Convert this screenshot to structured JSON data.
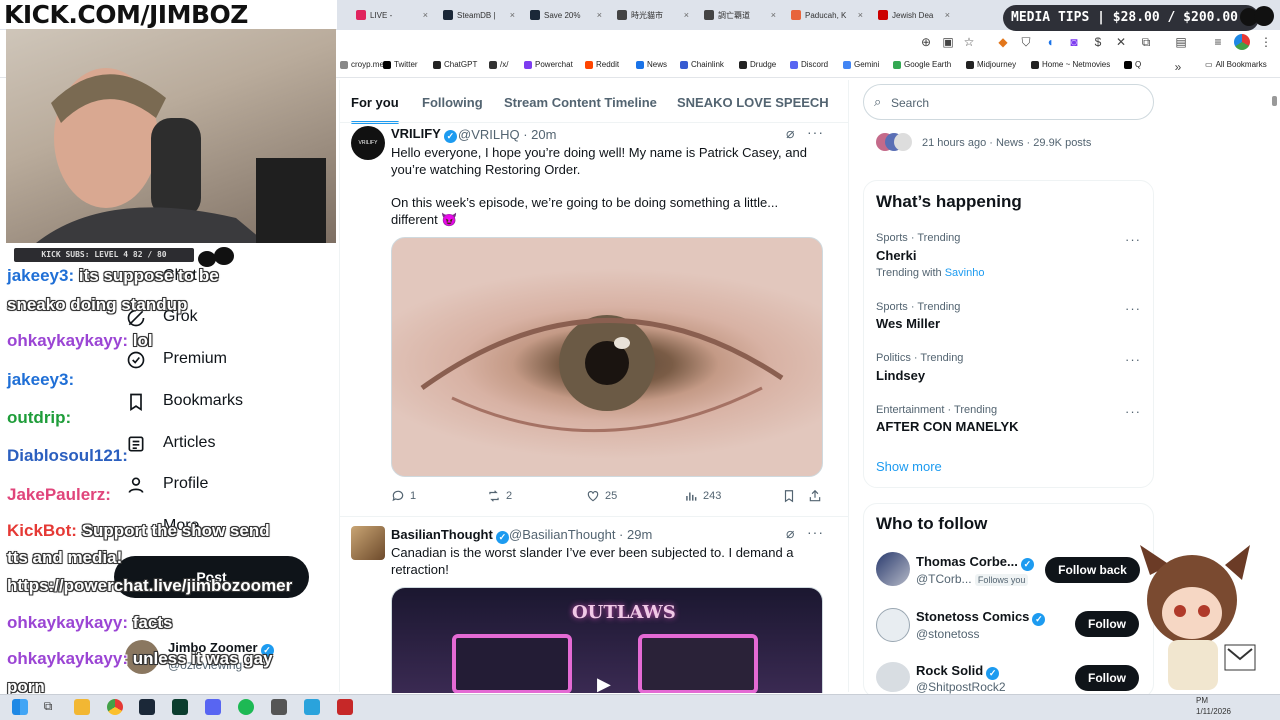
{
  "browser": {
    "tabs": [
      {
        "label": "LIVE - ",
        "color": "#e0245e"
      },
      {
        "label": "SteamDB |",
        "color": "#1b2838"
      },
      {
        "label": "Save 20%",
        "color": "#1b2838"
      },
      {
        "label": "時光貓市",
        "color": "#444444"
      },
      {
        "label": "調亡覇道",
        "color": "#444444"
      },
      {
        "label": "Paducah, K",
        "color": "#e8643b"
      },
      {
        "label": "Jewish Dea",
        "color": "#cc0000"
      }
    ],
    "bookmarks": [
      {
        "label": "croyp.me",
        "color": "#888888"
      },
      {
        "label": "Twitter",
        "color": "#000000"
      },
      {
        "label": "ChatGPT",
        "color": "#222222"
      },
      {
        "label": "/x/",
        "color": "#333333"
      },
      {
        "label": "Powerchat",
        "color": "#7d3cf0"
      },
      {
        "label": "Reddit",
        "color": "#ff4500"
      },
      {
        "label": "News",
        "color": "#1a73e8"
      },
      {
        "label": "Chainlink",
        "color": "#375bd2"
      },
      {
        "label": "Drudge",
        "color": "#222222"
      },
      {
        "label": "Discord",
        "color": "#5865f2"
      },
      {
        "label": "Gemini",
        "color": "#4285f4"
      },
      {
        "label": "Google Earth",
        "color": "#34a853"
      },
      {
        "label": "Midjourney",
        "color": "#222222"
      },
      {
        "label": "Home ~ Netmovies",
        "color": "#222222"
      },
      {
        "label": "Q",
        "color": "#000000"
      }
    ],
    "all_bookmarks": "All Bookmarks"
  },
  "overlay": {
    "banner": "KICK.COM/JIMBOZ",
    "media_tips": "MEDIA TIPS | $28.00 / $200.00",
    "subs": "KICK SUBS: LEVEL 4 82 / 80",
    "chat": [
      {
        "user": "jakeey3:",
        "user_color": "#1f6fd6",
        "msg": "its suppose to be"
      },
      {
        "user": "",
        "user_color": "#1f6fd6",
        "msg": "sneako doing standup"
      },
      {
        "user": "ohkaykaykayy:",
        "user_color": "#9b45d4",
        "msg": "lol"
      },
      {
        "user": "jakeey3:",
        "user_color": "#1f6fd6",
        "msg": ""
      },
      {
        "user": "outdrip:",
        "user_color": "#1f9d3a",
        "msg": ""
      },
      {
        "user": "Diablosoul121:",
        "user_color": "#2b5fbf",
        "msg": ""
      },
      {
        "user": "JakePaulerz:",
        "user_color": "#e0457b",
        "msg": ""
      },
      {
        "user": "KickBot:",
        "user_color": "#e53935",
        "msg": "Support the show send"
      },
      {
        "user": "",
        "user_color": "#e53935",
        "msg": "tts and media!"
      },
      {
        "user": "",
        "user_color": "#e53935",
        "msg": "https://powerchat.live/jimbozoomer"
      },
      {
        "user": "ohkaykaykayy:",
        "user_color": "#9b45d4",
        "msg": "facts"
      },
      {
        "user": "ohkaykaykayy:",
        "user_color": "#9b45d4",
        "msg": "unless it was gay"
      },
      {
        "user": "",
        "user_color": "#9b45d4",
        "msg": "porn"
      }
    ]
  },
  "xnav": {
    "items": [
      "Chat",
      "Grok",
      "Premium",
      "Bookmarks",
      "Articles",
      "Profile",
      "More"
    ],
    "post": "Post",
    "account_name": "Jimbo Zoomer",
    "account_handle": "@ozleviewing"
  },
  "feed": {
    "tabs": [
      "For you",
      "Following",
      "Stream Content Timeline",
      "SNEAKO LOVE SPEECH"
    ],
    "tweets": [
      {
        "name": "VRILIFY",
        "handle": "@VRILHQ · 20m",
        "avatar_text": "VRILIFY",
        "text1": "Hello everyone, I hope you’re doing well! My name is Patrick Casey, and you’re watching Restoring Order.",
        "text2": "On this week’s episode, we’re going to be doing something a little... different 😈",
        "replies": "1",
        "reposts": "2",
        "likes": "25",
        "views": "243"
      },
      {
        "name": "BasilianThought",
        "handle": "@BasilianThought · 29m",
        "text1": "Canadian is the worst slander I’ve ever been subjected to. I demand a retraction!",
        "media_title": "OUTLAWS"
      }
    ]
  },
  "sidebar": {
    "search_placeholder": "Search",
    "top_meta": "21 hours ago · News · 29.9K posts",
    "happening_title": "What’s happening",
    "trends": [
      {
        "category": "Sports · Trending",
        "name": "Cherki",
        "extra": "Trending with",
        "extra_link": "Savinho"
      },
      {
        "category": "Sports · Trending",
        "name": "Wes Miller"
      },
      {
        "category": "Politics · Trending",
        "name": "Lindsey"
      },
      {
        "category": "Entertainment · Trending",
        "name": "AFTER CON MANELYK"
      }
    ],
    "show_more": "Show more",
    "wtf_title": "Who to follow",
    "wtf": [
      {
        "name": "Thomas Corbe...",
        "handle": "@TCorb...",
        "follows_you": "Follows you",
        "button": "Follow back"
      },
      {
        "name": "Stonetoss Comics",
        "handle": "@stonetoss",
        "button": "Follow"
      },
      {
        "name": "Rock Solid",
        "handle": "@ShitpostRock2",
        "button": "Follow"
      }
    ]
  },
  "taskbar": {
    "date": "1/11/2026",
    "time": "PM"
  },
  "colors": {
    "accent": "#1d9bf0",
    "text": "#0f1419",
    "muted": "#536471"
  }
}
